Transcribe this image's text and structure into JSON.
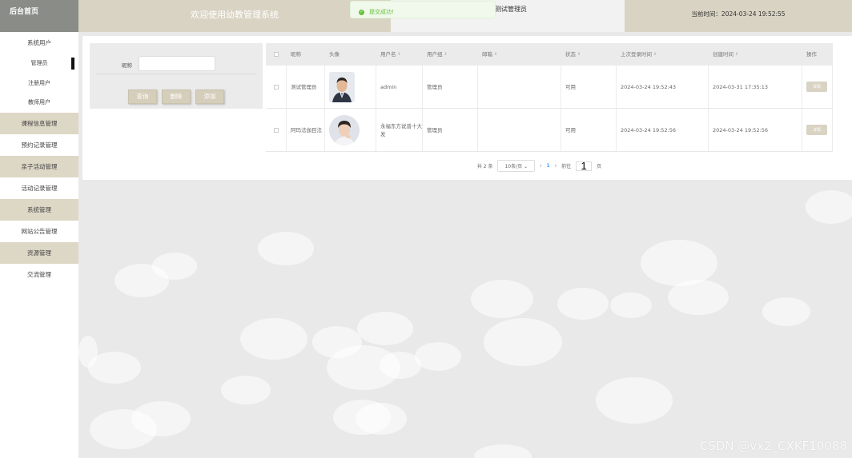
{
  "header": {
    "brand": "后台首页",
    "welcome": "欢迎使用幼教管理系统",
    "user": "测试管理员",
    "time_label": "当前时间：",
    "time_value": "2024-03-24 19:52:55"
  },
  "toast": {
    "message": "提交成功!",
    "icon": "check-circle-icon",
    "color": "#67c23a"
  },
  "sidebar": {
    "items": [
      {
        "label": "系统用户",
        "type": "group"
      },
      {
        "label": "管理员",
        "type": "sub",
        "active": true
      },
      {
        "label": "注册用户",
        "type": "sub"
      },
      {
        "label": "教师用户",
        "type": "sub"
      },
      {
        "label": "课程信息管理",
        "type": "shaded"
      },
      {
        "label": "预约记录管理",
        "type": "plain"
      },
      {
        "label": "亲子活动管理",
        "type": "shaded"
      },
      {
        "label": "活动记录管理",
        "type": "plain"
      },
      {
        "label": "系统管理",
        "type": "shaded"
      },
      {
        "label": "网站公告管理",
        "type": "plain"
      },
      {
        "label": "资源管理",
        "type": "shaded"
      },
      {
        "label": "交流管理",
        "type": "plain"
      }
    ]
  },
  "search": {
    "label": "昵称",
    "value": "",
    "buttons": {
      "query": "查询",
      "delete": "删除",
      "add": "添加"
    }
  },
  "table": {
    "columns": [
      "",
      "昵称",
      "头像",
      "用户名",
      "用户组",
      "邮箱",
      "状态",
      "上次登录时间",
      "创建时间",
      "操作"
    ],
    "sortable": [
      false,
      false,
      false,
      true,
      true,
      true,
      true,
      true,
      true,
      false
    ],
    "rows": [
      {
        "nickname": "测试管理员",
        "username": "admin",
        "group": "管理员",
        "email": "",
        "status": "可用",
        "last_login": "2024-03-24 19:52:43",
        "created": "2024-03-31 17:35:13",
        "action": "详情"
      },
      {
        "nickname": "阿玛法伽目法",
        "username": "永福东方说普十大发",
        "group": "管理员",
        "email": "",
        "status": "可用",
        "last_login": "2024-03-24 19:52:56",
        "created": "2024-03-24 19:52:56",
        "action": "详情"
      }
    ]
  },
  "pagination": {
    "total": "共 2 条",
    "page_size": "10条/页",
    "prev": "‹",
    "current": "1",
    "next": "›",
    "goto_label": "前往",
    "goto_value": "1",
    "page_unit": "页"
  },
  "watermark": "CSDN @vx2_CXKF10088",
  "colors": {
    "accent": "#d9d3c3",
    "brand_bg": "#8a8c88",
    "success": "#67c23a",
    "page_bg": "#e9e9e9"
  }
}
